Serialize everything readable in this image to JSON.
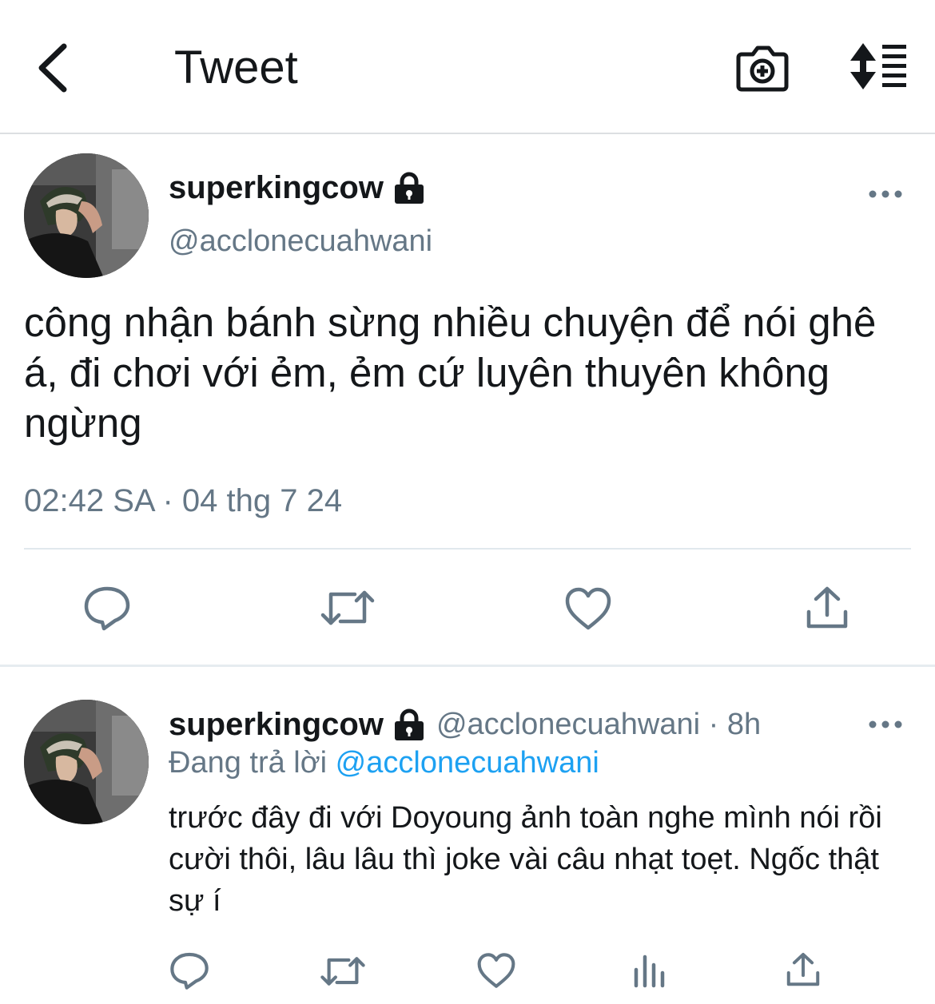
{
  "header": {
    "title": "Tweet",
    "back_icon": "chevron-left-icon",
    "camera_icon": "camera-plus-icon",
    "sort_icon": "sort-lines-icon"
  },
  "tweet": {
    "display_name": "superkingcow",
    "handle": "@acclonecuahwani",
    "text": "công nhận bánh sừng nhiều chuyện để nói ghê á, đi chơi với ẻm, ẻm cứ luyên thuyên không ngừng",
    "timestamp": "02:42 SA · 04 thg 7 24",
    "actions": [
      "reply-icon",
      "retweet-icon",
      "like-icon",
      "share-icon"
    ]
  },
  "reply": {
    "display_name": "superkingcow",
    "meta": "@acclonecuahwani · 8h",
    "replying_prefix": "Đang trả lời",
    "replying_to": "@acclonecuahwani",
    "text": "trước đây đi với Doyoung ảnh toàn nghe mình nói rồi cười thôi, lâu lâu thì joke vài câu nhạt toẹt. Ngốc thật sự í",
    "actions": [
      "reply-icon",
      "retweet-icon",
      "like-icon",
      "analytics-icon",
      "share-icon"
    ]
  },
  "colors": {
    "text": "#14171a",
    "secondary": "#657786",
    "link": "#1da1f2",
    "divider": "#e1e8ed",
    "icon": "#657786"
  }
}
